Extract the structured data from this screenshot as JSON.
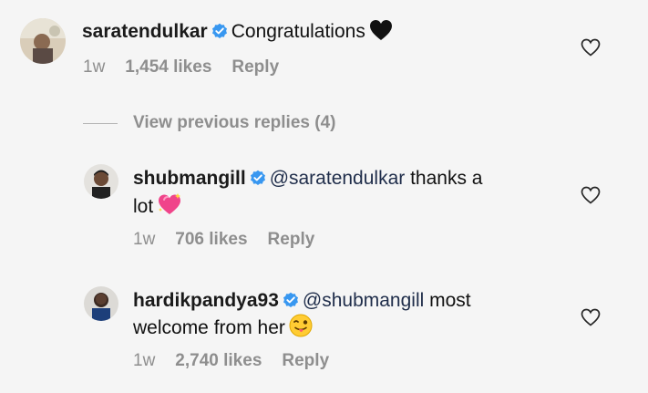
{
  "colors": {
    "background": "#f5f5f5",
    "meta_gray": "#8e8e8e",
    "verified_blue": "#3897f0"
  },
  "comments": [
    {
      "username": "saratendulkar",
      "verified": true,
      "text": "Congratulations",
      "emoji": "black-heart-icon",
      "time": "1w",
      "likes": "1,454 likes",
      "reply": "Reply"
    },
    {
      "username": "shubmangill",
      "verified": true,
      "mention": "@saratendulkar",
      "text_line1": " thanks a",
      "text_line2": "lot",
      "emoji": "sparkling-heart-icon",
      "time": "1w",
      "likes": "706 likes",
      "reply": "Reply"
    },
    {
      "username": "hardikpandya93",
      "verified": true,
      "mention": "@shubmangill",
      "text_line1": " most",
      "text_line2": "welcome from her",
      "emoji": "winking-tongue-face-icon",
      "time": "1w",
      "likes": "2,740 likes",
      "reply": "Reply"
    }
  ],
  "view_previous_replies": "View previous replies (4)"
}
